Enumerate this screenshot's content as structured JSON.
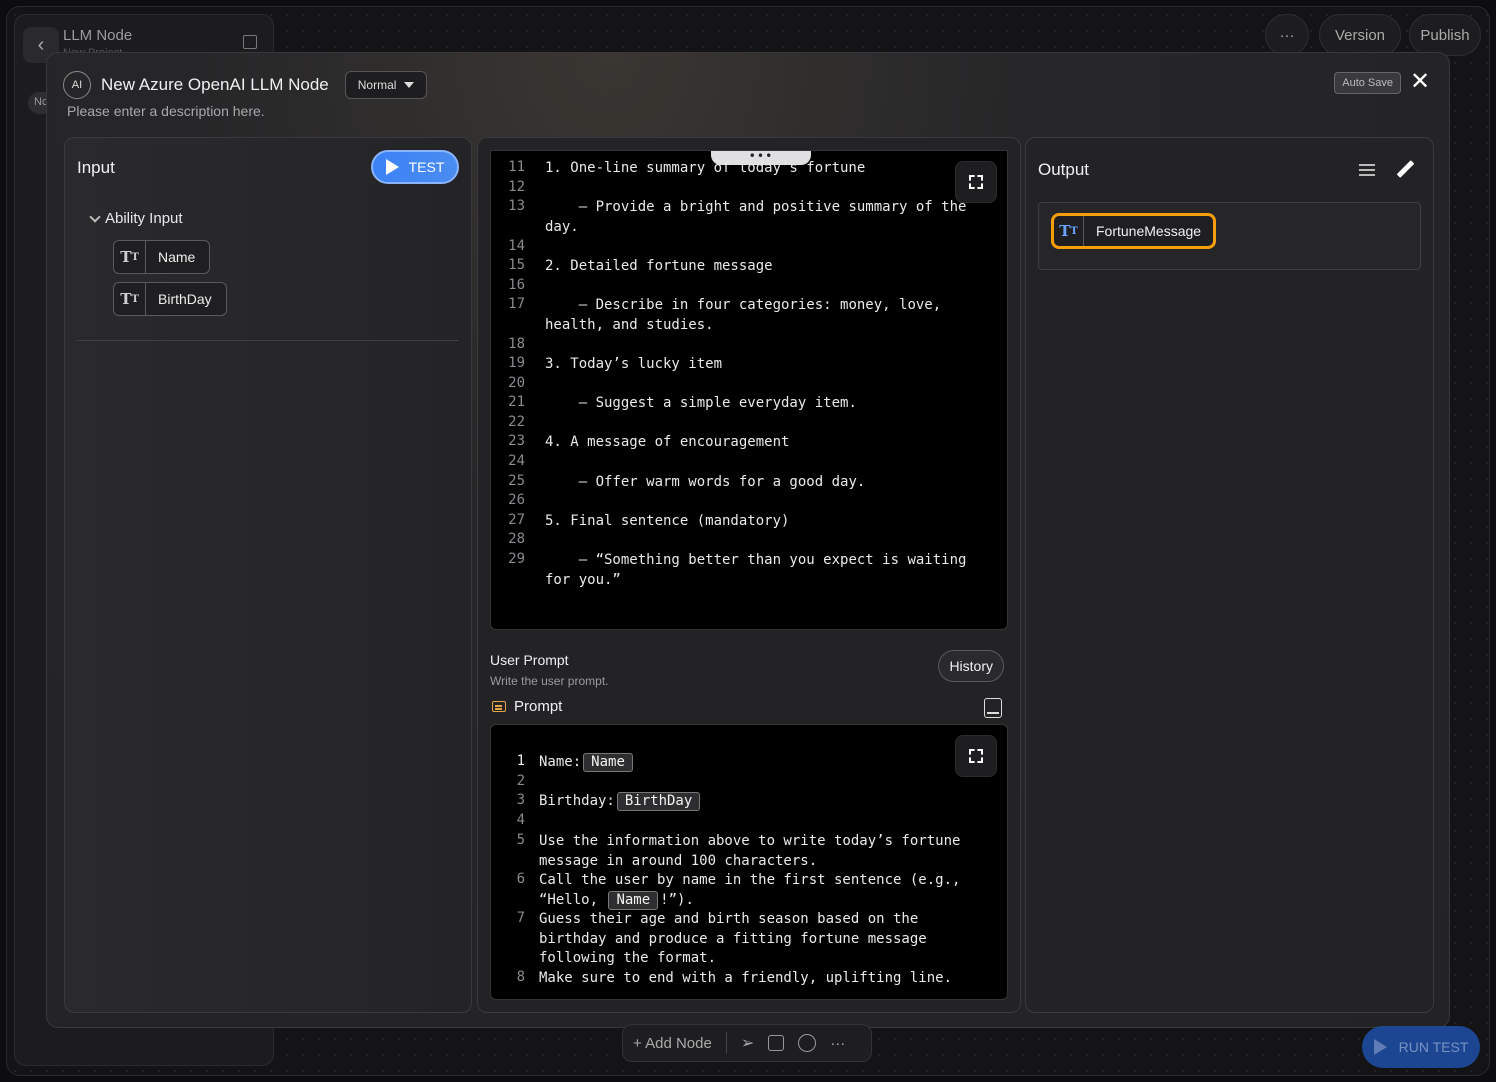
{
  "background": {
    "sidebar_title": "LLM Node",
    "sidebar_subtitle": "New Project",
    "sidebar_pill": "Nc",
    "more_label": "···",
    "version_label": "Version",
    "publish_label": "Publish"
  },
  "modal": {
    "badge": "AI",
    "title": "New Azure OpenAI LLM Node",
    "mode": "Normal",
    "description": "Please enter a description here.",
    "auto_save": "Auto Save",
    "close": "✕"
  },
  "input_panel": {
    "heading": "Input",
    "test_label": "TEST",
    "ability_label": "Ability Input",
    "variables": [
      "Name",
      "BirthDay"
    ]
  },
  "system_editor": {
    "handle": "•••",
    "lines": [
      {
        "n": "11",
        "t": "1. One-line summary of today’s fortune"
      },
      {
        "n": "12",
        "t": ""
      },
      {
        "n": "13",
        "t": "    – Provide a bright and positive summary of the day."
      },
      {
        "n": "14",
        "t": ""
      },
      {
        "n": "15",
        "t": "2. Detailed fortune message"
      },
      {
        "n": "16",
        "t": ""
      },
      {
        "n": "17",
        "t": "    – Describe in four categories: money, love, health, and studies."
      },
      {
        "n": "18",
        "t": ""
      },
      {
        "n": "19",
        "t": "3. Today’s lucky item"
      },
      {
        "n": "20",
        "t": ""
      },
      {
        "n": "21",
        "t": "    – Suggest a simple everyday item."
      },
      {
        "n": "22",
        "t": ""
      },
      {
        "n": "23",
        "t": "4. A message of encouragement"
      },
      {
        "n": "24",
        "t": ""
      },
      {
        "n": "25",
        "t": "    – Offer warm words for a good day."
      },
      {
        "n": "26",
        "t": ""
      },
      {
        "n": "27",
        "t": "5. Final sentence (mandatory)"
      },
      {
        "n": "28",
        "t": ""
      },
      {
        "n": "29",
        "t": "    – “Something better than you expect is waiting for you.”"
      }
    ]
  },
  "user_prompt": {
    "label": "User Prompt",
    "sublabel": "Write the user prompt.",
    "history_label": "History",
    "prompt_label": "Prompt",
    "line1_prefix": "Name:",
    "line1_var": "Name",
    "line3_prefix": "Birthday:",
    "line3_var": "BirthDay",
    "line5": "Use the information above to write today’s fortune message in around 100 characters.",
    "line6_a": "Call the user by name in the first sentence (e.g., “Hello, ",
    "line6_var": "Name",
    "line6_b": "!”).",
    "line7": "Guess their age and birth season based on the birthday and produce a fitting fortune message following the format.",
    "line8": "Make sure to end with a friendly, uplifting line.",
    "numbers": [
      "1",
      "2",
      "3",
      "4",
      "5",
      "6",
      "7",
      "8"
    ]
  },
  "output_panel": {
    "heading": "Output",
    "variable": "FortuneMessage"
  },
  "toolbar": {
    "add_node": "+ Add Node",
    "more": "···",
    "run_test": "RUN TEST"
  },
  "colors": {
    "accent": "#3b82f6",
    "highlight": "#f59e0b"
  }
}
